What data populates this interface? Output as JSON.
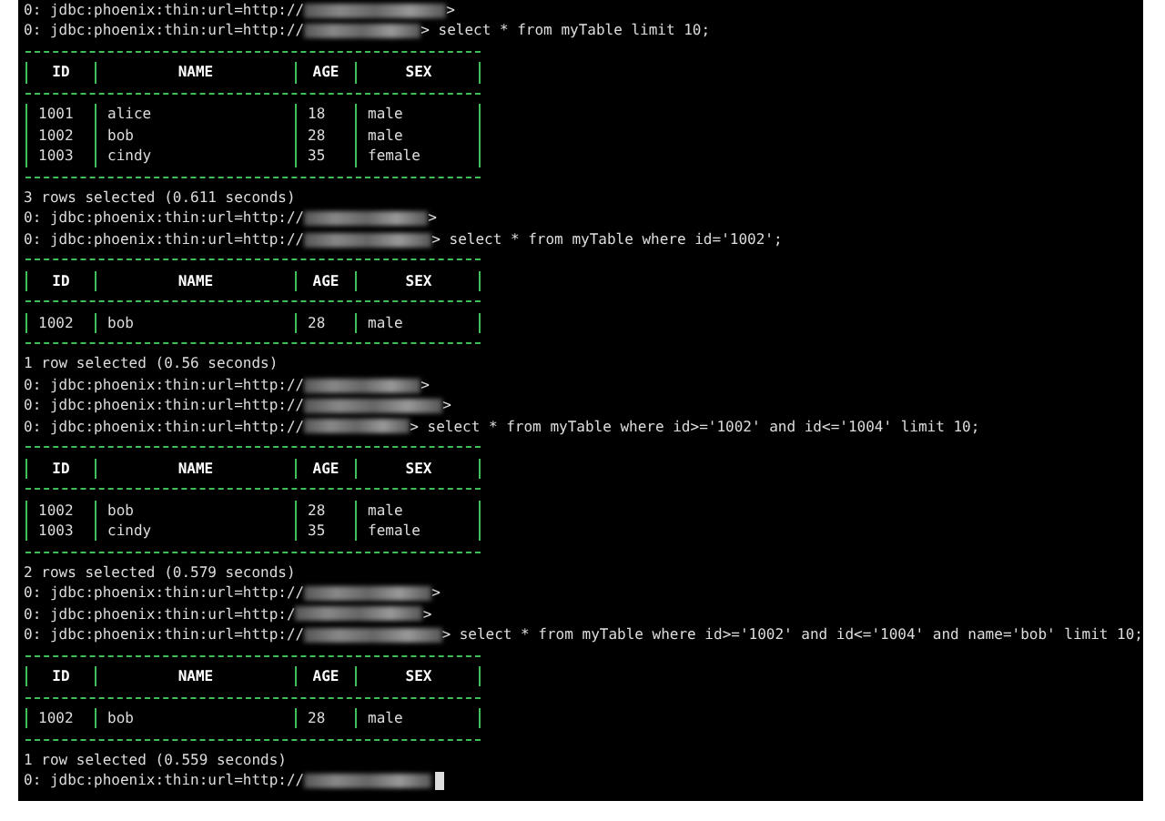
{
  "terminal": {
    "lines": [
      {
        "kind": "prompt",
        "prefix": "0: jdbc:phoenix:thin:url=http://",
        "command": ">"
      },
      {
        "kind": "prompt",
        "prefix": "0: jdbc:phoenix:thin:url=http://",
        "command": "> select * from myTable limit 10;"
      },
      {
        "kind": "table",
        "columns": [
          "ID",
          "NAME",
          "AGE",
          "SEX"
        ],
        "rows": [
          [
            "1001",
            "alice",
            "18",
            "male"
          ],
          [
            "1002",
            "bob",
            "28",
            "male"
          ],
          [
            "1003",
            "cindy",
            "35",
            "female"
          ]
        ]
      },
      {
        "kind": "status",
        "text": "3 rows selected (0.611 seconds)"
      },
      {
        "kind": "prompt",
        "prefix": "0: jdbc:phoenix:thin:url=http://",
        "command": ">"
      },
      {
        "kind": "prompt",
        "prefix": "0: jdbc:phoenix:thin:url=http://",
        "command": "> select * from myTable where id='1002';"
      },
      {
        "kind": "table",
        "columns": [
          "ID",
          "NAME",
          "AGE",
          "SEX"
        ],
        "rows": [
          [
            "1002",
            "bob",
            "28",
            "male"
          ]
        ]
      },
      {
        "kind": "status",
        "text": "1 row selected (0.56 seconds)"
      },
      {
        "kind": "prompt",
        "prefix": "0: jdbc:phoenix:thin:url=http://",
        "command": ">"
      },
      {
        "kind": "prompt",
        "prefix": "0: jdbc:phoenix:thin:url=http://",
        "command": ">"
      },
      {
        "kind": "prompt",
        "prefix": "0: jdbc:phoenix:thin:url=http://",
        "command": "> select * from myTable where id>='1002' and id<='1004' limit 10;"
      },
      {
        "kind": "table",
        "columns": [
          "ID",
          "NAME",
          "AGE",
          "SEX"
        ],
        "rows": [
          [
            "1002",
            "bob",
            "28",
            "male"
          ],
          [
            "1003",
            "cindy",
            "35",
            "female"
          ]
        ]
      },
      {
        "kind": "status",
        "text": "2 rows selected (0.579 seconds)"
      },
      {
        "kind": "prompt",
        "prefix": "0: jdbc:phoenix:thin:url=http://",
        "command": ">"
      },
      {
        "kind": "prompt",
        "prefix": "0: jdbc:phoenix:thin:url=http:/",
        "command": ">"
      },
      {
        "kind": "prompt",
        "prefix": "0: jdbc:phoenix:thin:url=http://",
        "command": "> select * from myTable where id>='1002' and id<='1004' and name='bob' limit 10;"
      },
      {
        "kind": "table",
        "columns": [
          "ID",
          "NAME",
          "AGE",
          "SEX"
        ],
        "rows": [
          [
            "1002",
            "bob",
            "28",
            "male"
          ]
        ]
      },
      {
        "kind": "status",
        "text": "1 row selected (0.559 seconds)"
      },
      {
        "kind": "prompt",
        "prefix": "0: jdbc:phoenix:thin:url=http://",
        "cursor": true
      }
    ]
  }
}
